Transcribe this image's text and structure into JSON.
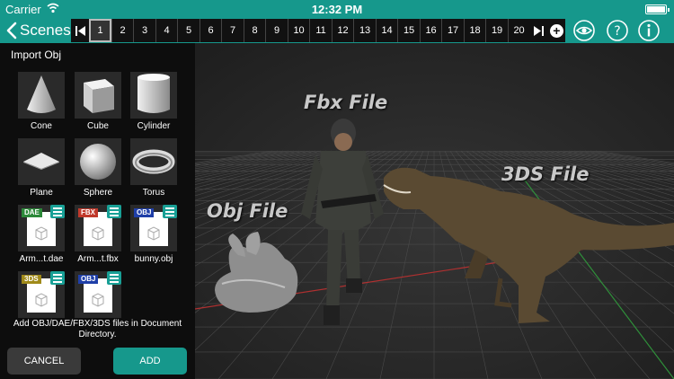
{
  "status_bar": {
    "carrier": "Carrier",
    "time": "12:32 PM"
  },
  "toolbar": {
    "back_label": "Scenes",
    "pages": [
      "1",
      "2",
      "3",
      "4",
      "5",
      "6",
      "7",
      "8",
      "9",
      "10",
      "11",
      "12",
      "13",
      "14",
      "15",
      "16",
      "17",
      "18",
      "19",
      "20"
    ],
    "active_page": "1"
  },
  "panel": {
    "title": "Import Obj",
    "primitives": [
      "Cone",
      "Cube",
      "Cylinder",
      "Plane",
      "Sphere",
      "Torus"
    ],
    "files": [
      {
        "type": "DAE",
        "name": "Arm...t.dae",
        "tag_color": "#2d8a3a"
      },
      {
        "type": "FBX",
        "name": "Arm...t.fbx",
        "tag_color": "#c0392b"
      },
      {
        "type": "OBJ",
        "name": "bunny.obj",
        "tag_color": "#1f3fa8"
      },
      {
        "type": "3DS",
        "name": "",
        "tag_color": "#a08a1a"
      },
      {
        "type": "OBJ",
        "name": "",
        "tag_color": "#1f3fa8"
      }
    ],
    "hint": "Add OBJ/DAE/FBX/3DS files in Document Directory.",
    "cancel_label": "CANCEL",
    "add_label": "ADD"
  },
  "viewport": {
    "labels": {
      "fbx": "Fbx File",
      "obj": "Obj File",
      "tds": "3DS File"
    }
  },
  "colors": {
    "accent": "#16988c",
    "panel_bg": "#0d0d0d",
    "viewport_bg": "#2e2e2e"
  }
}
